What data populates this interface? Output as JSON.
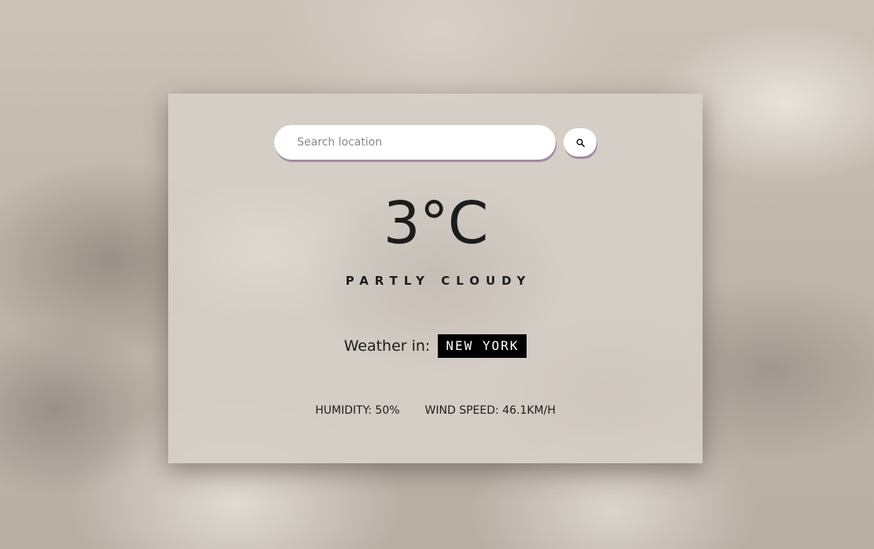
{
  "search": {
    "placeholder": "Search location",
    "value": "",
    "button_icon": "search-icon"
  },
  "weather": {
    "temperature": "3°C",
    "condition": "PARTLY CLOUDY",
    "location_label": "Weather in:",
    "location": "NEW YORK",
    "humidity": "HUMIDITY: 50%",
    "wind_speed": "WIND SPEED: 46.1KM/H"
  },
  "colors": {
    "card_background": "#d6cfc8",
    "accent_shadow": "#a08aa8",
    "text": "#1c1c1c",
    "location_badge": "#000000"
  }
}
